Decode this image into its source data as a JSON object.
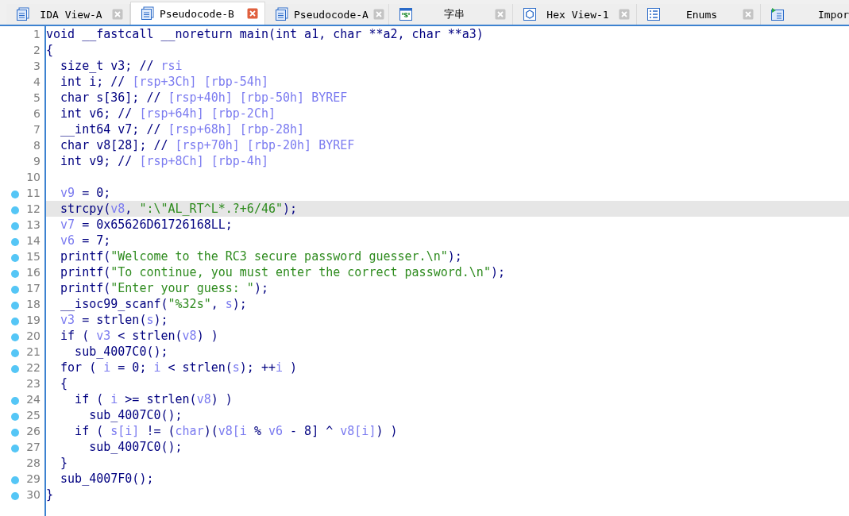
{
  "tabs": [
    {
      "label": "IDA View-A",
      "kind": "doc",
      "selected": false,
      "closable": true
    },
    {
      "label": "Pseudocode-B",
      "kind": "doc",
      "selected": true,
      "closable": true
    },
    {
      "label": "Pseudocode-A",
      "kind": "doc",
      "selected": false,
      "closable": true
    },
    {
      "label": "字串",
      "kind": "strings",
      "selected": false,
      "closable": true
    },
    {
      "label": "Hex View-1",
      "kind": "hex",
      "selected": false,
      "closable": true
    },
    {
      "label": "Enums",
      "kind": "enum",
      "selected": false,
      "closable": true
    },
    {
      "label": "Impor",
      "kind": "import",
      "selected": false,
      "closable": false
    }
  ],
  "lines": [
    {
      "n": "1",
      "dot": false,
      "selected": false,
      "tokens": [
        {
          "kind": "code",
          "text": "void __fastcall __noreturn main(int a1, char **a2, char **a3)"
        }
      ]
    },
    {
      "n": "2",
      "dot": false,
      "selected": false,
      "tokens": [
        {
          "kind": "code",
          "text": "{"
        }
      ]
    },
    {
      "n": "3",
      "dot": false,
      "selected": false,
      "tokens": [
        {
          "kind": "code",
          "text": "  size_t v3; // "
        },
        {
          "kind": "var",
          "text": "rsi"
        }
      ]
    },
    {
      "n": "4",
      "dot": false,
      "selected": false,
      "tokens": [
        {
          "kind": "code",
          "text": "  int i; // "
        },
        {
          "kind": "var",
          "text": "[rsp+3Ch] [rbp-54h]"
        }
      ]
    },
    {
      "n": "5",
      "dot": false,
      "selected": false,
      "tokens": [
        {
          "kind": "code",
          "text": "  char s[36]; // "
        },
        {
          "kind": "var",
          "text": "[rsp+40h] [rbp-50h] BYREF"
        }
      ]
    },
    {
      "n": "6",
      "dot": false,
      "selected": false,
      "tokens": [
        {
          "kind": "code",
          "text": "  int v6; // "
        },
        {
          "kind": "var",
          "text": "[rsp+64h] [rbp-2Ch]"
        }
      ]
    },
    {
      "n": "7",
      "dot": false,
      "selected": false,
      "tokens": [
        {
          "kind": "code",
          "text": "  __int64 v7; // "
        },
        {
          "kind": "var",
          "text": "[rsp+68h] [rbp-28h]"
        }
      ]
    },
    {
      "n": "8",
      "dot": false,
      "selected": false,
      "tokens": [
        {
          "kind": "code",
          "text": "  char v8[28]; // "
        },
        {
          "kind": "var",
          "text": "[rsp+70h] [rbp-20h] BYREF"
        }
      ]
    },
    {
      "n": "9",
      "dot": false,
      "selected": false,
      "tokens": [
        {
          "kind": "code",
          "text": "  int v9; // "
        },
        {
          "kind": "var",
          "text": "[rsp+8Ch] [rbp-4h]"
        }
      ]
    },
    {
      "n": "10",
      "dot": false,
      "selected": false
    },
    {
      "n": "11",
      "dot": true,
      "selected": false,
      "tokens": [
        {
          "kind": "var",
          "text": "  v9"
        },
        {
          "kind": "code",
          "text": " = 0;"
        }
      ]
    },
    {
      "n": "12",
      "dot": true,
      "selected": true,
      "tokens": [
        {
          "kind": "code",
          "text": "  strcpy("
        },
        {
          "kind": "var",
          "text": "v8"
        },
        {
          "kind": "code",
          "text": ", "
        },
        {
          "kind": "str",
          "text": "\":\\\"AL_RT^L*.?+6/46\""
        },
        {
          "kind": "code",
          "text": ");"
        }
      ]
    },
    {
      "n": "13",
      "dot": true,
      "selected": false,
      "tokens": [
        {
          "kind": "var",
          "text": "  v7"
        },
        {
          "kind": "code",
          "text": " = 0x65626D61726168LL;"
        }
      ]
    },
    {
      "n": "14",
      "dot": true,
      "selected": false,
      "tokens": [
        {
          "kind": "var",
          "text": "  v6"
        },
        {
          "kind": "code",
          "text": " = 7;"
        }
      ]
    },
    {
      "n": "15",
      "dot": true,
      "selected": false,
      "tokens": [
        {
          "kind": "code",
          "text": "  printf("
        },
        {
          "kind": "str",
          "text": "\"Welcome to the RC3 secure password guesser.\\n\""
        },
        {
          "kind": "code",
          "text": ");"
        }
      ]
    },
    {
      "n": "16",
      "dot": true,
      "selected": false,
      "tokens": [
        {
          "kind": "code",
          "text": "  printf("
        },
        {
          "kind": "str",
          "text": "\"To continue, you must enter the correct password.\\n\""
        },
        {
          "kind": "code",
          "text": ");"
        }
      ]
    },
    {
      "n": "17",
      "dot": true,
      "selected": false,
      "tokens": [
        {
          "kind": "code",
          "text": "  printf("
        },
        {
          "kind": "str",
          "text": "\"Enter your guess: \""
        },
        {
          "kind": "code",
          "text": ");"
        }
      ]
    },
    {
      "n": "18",
      "dot": true,
      "selected": false,
      "tokens": [
        {
          "kind": "code",
          "text": "  __isoc99_scanf("
        },
        {
          "kind": "str",
          "text": "\"%32s\""
        },
        {
          "kind": "code",
          "text": ", "
        },
        {
          "kind": "var",
          "text": "s"
        },
        {
          "kind": "code",
          "text": ");"
        }
      ]
    },
    {
      "n": "19",
      "dot": true,
      "selected": false,
      "tokens": [
        {
          "kind": "var",
          "text": "  v3"
        },
        {
          "kind": "code",
          "text": " = strlen("
        },
        {
          "kind": "var",
          "text": "s"
        },
        {
          "kind": "code",
          "text": ");"
        }
      ]
    },
    {
      "n": "20",
      "dot": true,
      "selected": false,
      "tokens": [
        {
          "kind": "code",
          "text": "  if ( "
        },
        {
          "kind": "var",
          "text": "v3"
        },
        {
          "kind": "code",
          "text": " < strlen("
        },
        {
          "kind": "var",
          "text": "v8"
        },
        {
          "kind": "code",
          "text": ") )"
        }
      ]
    },
    {
      "n": "21",
      "dot": true,
      "selected": false,
      "tokens": [
        {
          "kind": "code",
          "text": "    sub_4007C0();"
        }
      ]
    },
    {
      "n": "22",
      "dot": true,
      "selected": false,
      "tokens": [
        {
          "kind": "code",
          "text": "  for ( "
        },
        {
          "kind": "var",
          "text": "i"
        },
        {
          "kind": "code",
          "text": " = 0; "
        },
        {
          "kind": "var",
          "text": "i"
        },
        {
          "kind": "code",
          "text": " < strlen("
        },
        {
          "kind": "var",
          "text": "s"
        },
        {
          "kind": "code",
          "text": "); ++"
        },
        {
          "kind": "var",
          "text": "i"
        },
        {
          "kind": "code",
          "text": " )"
        }
      ]
    },
    {
      "n": "23",
      "dot": false,
      "selected": false,
      "tokens": [
        {
          "kind": "code",
          "text": "  {"
        }
      ]
    },
    {
      "n": "24",
      "dot": true,
      "selected": false,
      "tokens": [
        {
          "kind": "code",
          "text": "    if ( "
        },
        {
          "kind": "var",
          "text": "i"
        },
        {
          "kind": "code",
          "text": " >= strlen("
        },
        {
          "kind": "var",
          "text": "v8"
        },
        {
          "kind": "code",
          "text": ") )"
        }
      ]
    },
    {
      "n": "25",
      "dot": true,
      "selected": false,
      "tokens": [
        {
          "kind": "code",
          "text": "      sub_4007C0();"
        }
      ]
    },
    {
      "n": "26",
      "dot": true,
      "selected": false,
      "tokens": [
        {
          "kind": "code",
          "text": "    if ( "
        },
        {
          "kind": "var",
          "text": "s[i]"
        },
        {
          "kind": "code",
          "text": " != ("
        },
        {
          "kind": "var",
          "text": "char"
        },
        {
          "kind": "code",
          "text": ")("
        },
        {
          "kind": "var",
          "text": "v8[i"
        },
        {
          "kind": "code",
          "text": " % "
        },
        {
          "kind": "var",
          "text": "v6"
        },
        {
          "kind": "code",
          "text": " - 8] ^ "
        },
        {
          "kind": "var",
          "text": "v8[i]"
        },
        {
          "kind": "code",
          "text": ") )"
        }
      ]
    },
    {
      "n": "27",
      "dot": true,
      "selected": false,
      "tokens": [
        {
          "kind": "code",
          "text": "      sub_4007C0();"
        }
      ]
    },
    {
      "n": "28",
      "dot": false,
      "selected": false,
      "tokens": [
        {
          "kind": "code",
          "text": "  }"
        }
      ]
    },
    {
      "n": "29",
      "dot": true,
      "selected": false,
      "tokens": [
        {
          "kind": "code",
          "text": "  sub_4007F0();"
        }
      ]
    },
    {
      "n": "30",
      "dot": true,
      "selected": false,
      "tokens": [
        {
          "kind": "code",
          "text": "}"
        }
      ]
    }
  ]
}
